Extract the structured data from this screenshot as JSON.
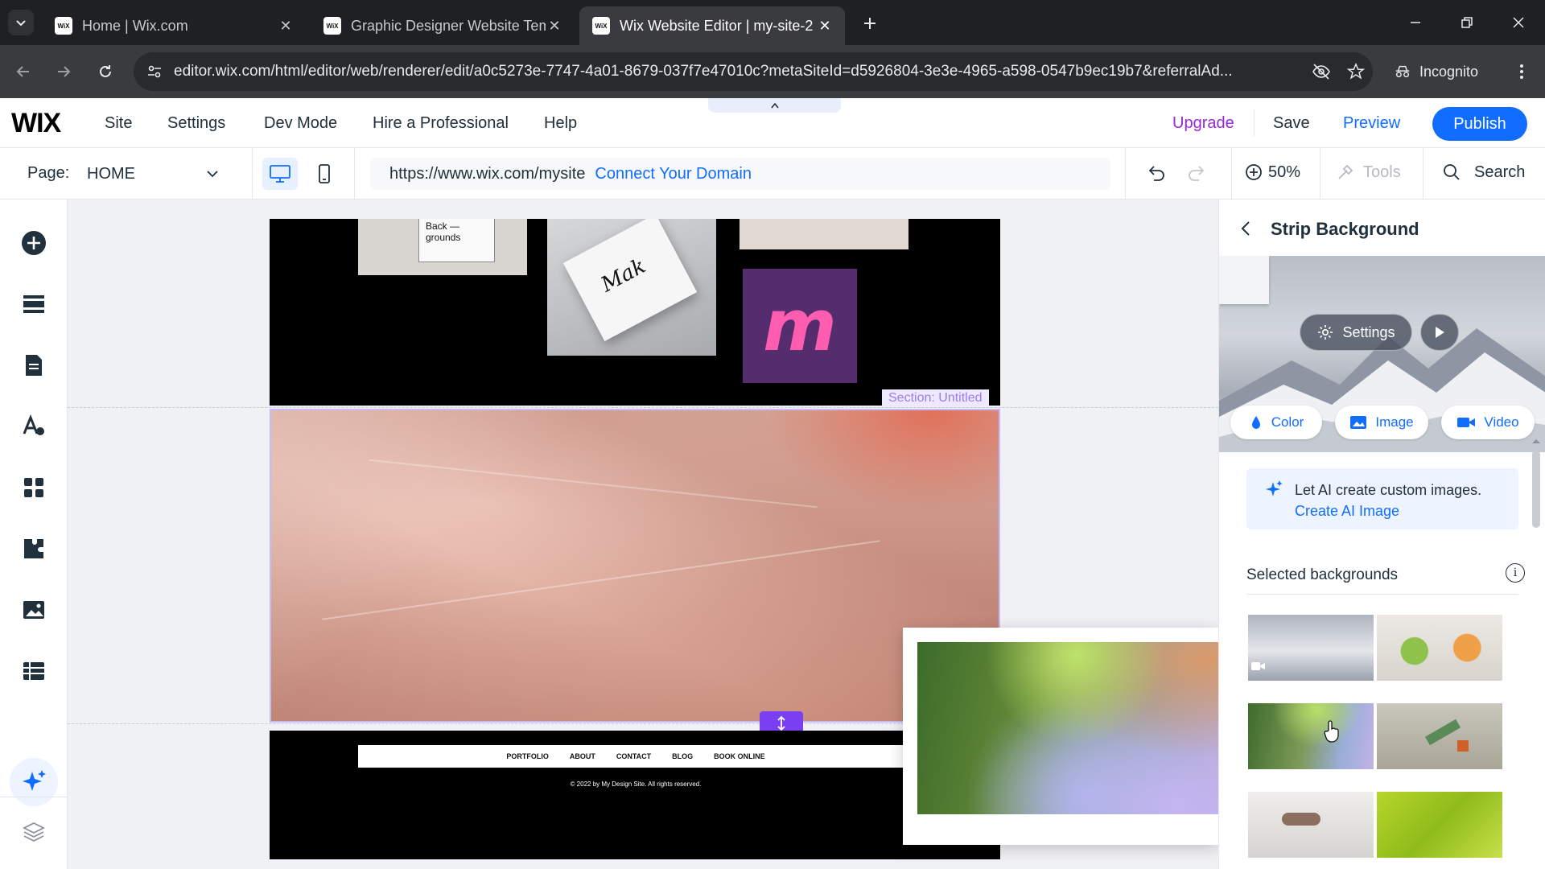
{
  "browser": {
    "tabs": [
      {
        "title": "Home | Wix.com",
        "favicon": "WiX"
      },
      {
        "title": "Graphic Designer Website Temp",
        "favicon": "WiX"
      },
      {
        "title": "Wix Website Editor | my-site-2",
        "favicon": "WiX"
      }
    ],
    "url": "editor.wix.com/html/editor/web/renderer/edit/a0c5273e-7747-4a01-8679-037f7e47010c?metaSiteId=d5926804-3e3e-4965-a598-0547b9ec19b7&referralAd...",
    "incognito_label": "Incognito"
  },
  "wix": {
    "logo": "WIX",
    "menu": [
      "Site",
      "Settings",
      "Dev Mode",
      "Hire a Professional",
      "Help"
    ],
    "upgrade": "Upgrade",
    "save": "Save",
    "preview": "Preview",
    "publish": "Publish"
  },
  "pagebar": {
    "page_label": "Page:",
    "page_value": "HOME",
    "site_url": "https://www.wix.com/mysite",
    "connect_domain": "Connect Your Domain",
    "zoom": "50%",
    "tools": "Tools",
    "search": "Search"
  },
  "canvas": {
    "card1_text": "Back — grounds",
    "card2_text": "Mak",
    "logo_letter": "m",
    "section_label": "Section: Untitled",
    "footer_nav": [
      "PORTFOLIO",
      "ABOUT",
      "CONTACT",
      "BLOG",
      "BOOK ONLINE"
    ],
    "copyright": "© 2022 by My Design Site. All rights reserved."
  },
  "panel": {
    "title": "Strip Background",
    "settings": "Settings",
    "color": "Color",
    "image": "Image",
    "video": "Video",
    "ai_text": "Let AI create custom images.",
    "ai_link": "Create AI Image",
    "selected": "Selected backgrounds"
  },
  "colors": {
    "accent": "#116dff",
    "upgrade": "#9a27d5",
    "section": "#9a7cf0",
    "handle": "#7b3ff2"
  }
}
